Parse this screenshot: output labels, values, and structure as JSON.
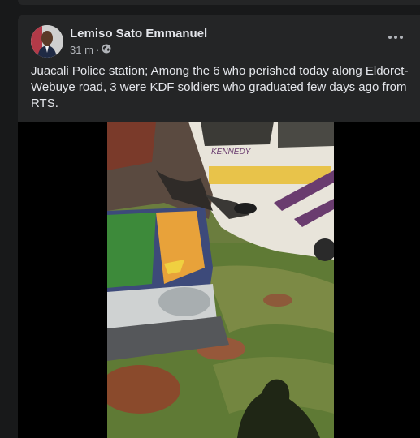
{
  "post": {
    "author": "Lemiso Sato Emmanuel",
    "time": "31 m",
    "separator": "·",
    "audience_icon": "globe-icon",
    "more_icon": "more-options-icon",
    "text": "Juacali Police station; Among the 6 who perished today along Eldoret-Webuye road, 3 were KDF soldiers who graduated few days ago from RTS."
  },
  "colors": {
    "page_bg": "#18191a",
    "card_bg": "#242526",
    "primary_text": "#e4e6eb",
    "secondary_text": "#b0b3b8"
  }
}
